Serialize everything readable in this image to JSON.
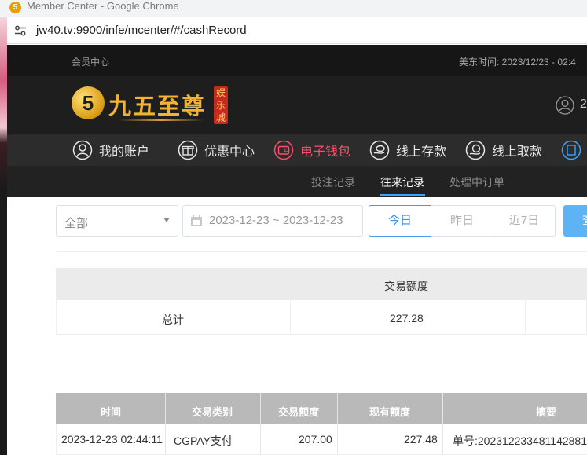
{
  "browser": {
    "window_title": "Member Center - Google Chrome",
    "url": "jw40.tv:9900/infe/mcenter/#/cashRecord"
  },
  "topbar": {
    "member_center": "会员中心",
    "time_label": "美东时间: 2023/12/23 - 02:4"
  },
  "logo": {
    "mark": "5",
    "name": "九五至尊",
    "tag": "娱乐城"
  },
  "header": {
    "user_partial": "2"
  },
  "nav": {
    "items": [
      {
        "label": "我的账户",
        "icon": "user-circle-icon",
        "active": false
      },
      {
        "label": "优惠中心",
        "icon": "gift-icon",
        "active": false
      },
      {
        "label": "电子钱包",
        "icon": "wallet-icon",
        "active": true
      },
      {
        "label": "线上存款",
        "icon": "deposit-icon",
        "active": false
      },
      {
        "label": "线上取款",
        "icon": "withdraw-icon",
        "active": false
      }
    ],
    "active_color": "#ff4d6a"
  },
  "subtabs": [
    {
      "label": "投注记录",
      "active": false
    },
    {
      "label": "往来记录",
      "active": true
    },
    {
      "label": "处理中订单",
      "active": false
    }
  ],
  "filters": {
    "type_select": "全部",
    "date_range": "2023-12-23 ~ 2023-12-23",
    "quick": [
      "今日",
      "昨日",
      "近7日"
    ],
    "search_partial": "查"
  },
  "summary": {
    "header": "交易额度",
    "total_label": "总计",
    "total_value": "227.28"
  },
  "records": {
    "columns": [
      "时间",
      "交易类别",
      "交易额度",
      "现有额度",
      "摘要"
    ],
    "rows": [
      {
        "time": "2023-12-23 02:44:11",
        "type": "CGPAY支付",
        "amount": "207.00",
        "balance": "227.48",
        "summary": "单号:202312233481142881"
      }
    ]
  }
}
